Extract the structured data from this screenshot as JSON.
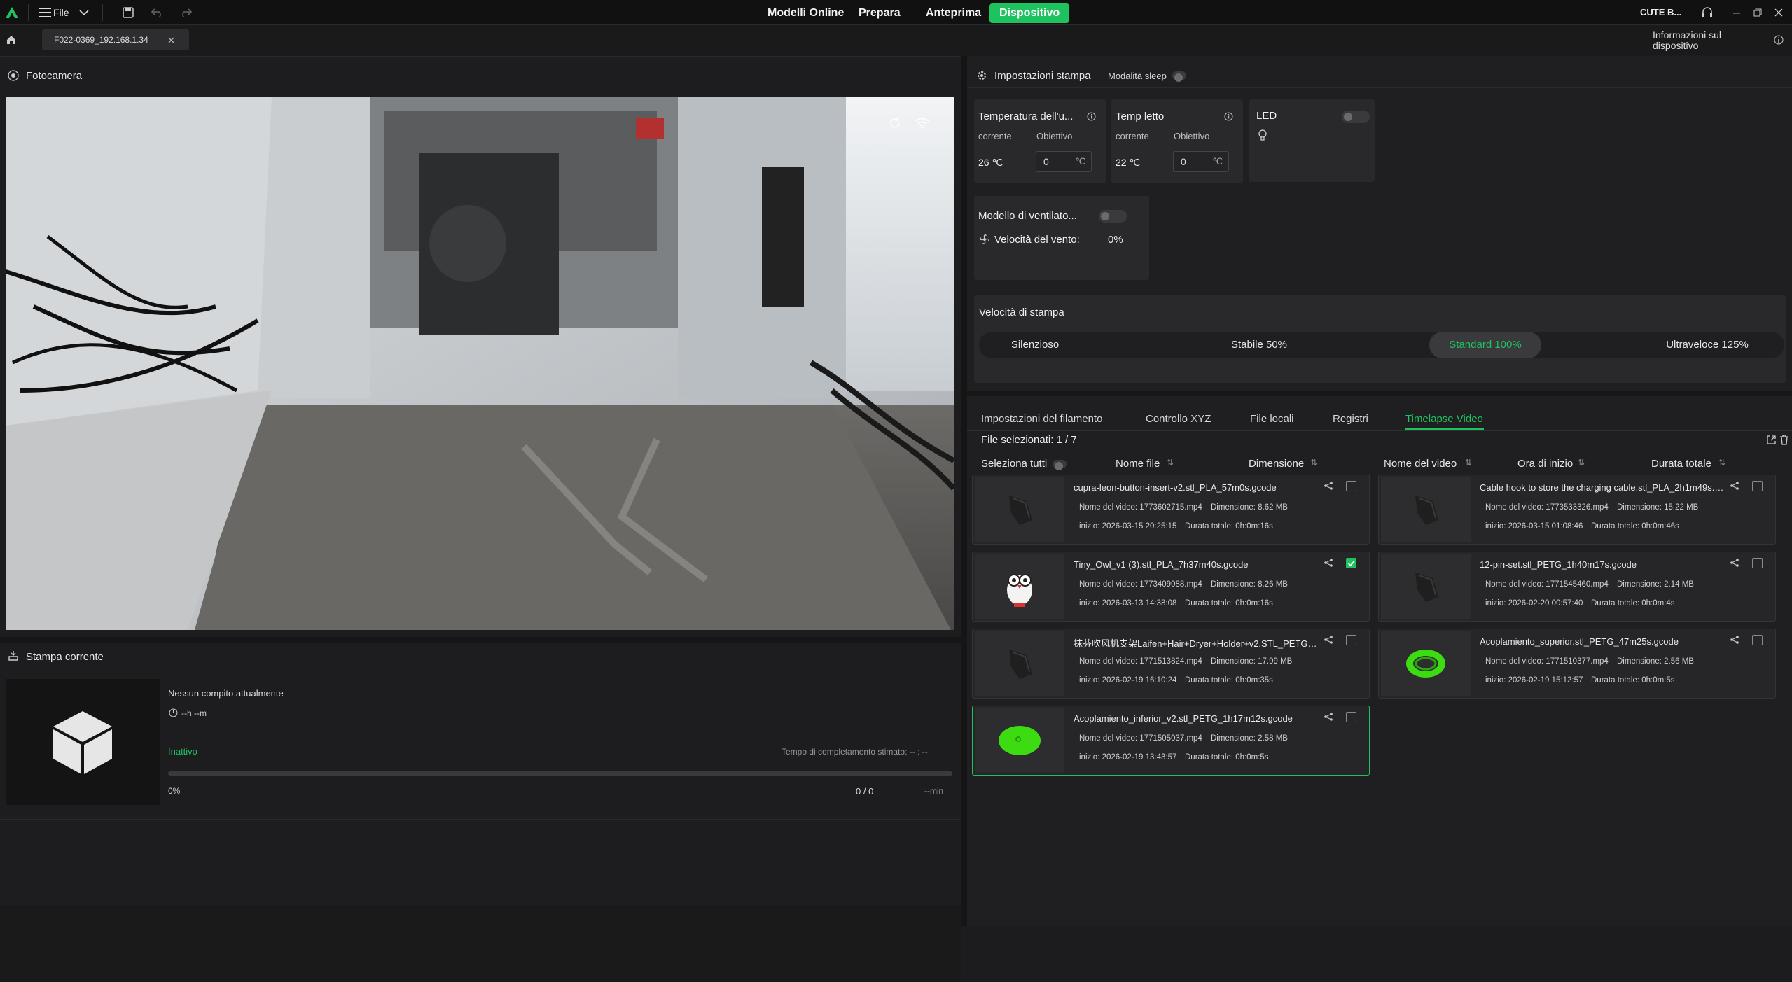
{
  "topbar": {
    "file_label": "File",
    "nav": [
      "Modelli Online",
      "Prepara",
      "Anteprima",
      "Dispositivo"
    ],
    "active_nav": "Dispositivo",
    "user": "CUTE B...",
    "accent_color": "#1ec25f"
  },
  "tabbar": {
    "device_tab": "F022-0369_192.168.1.34",
    "info_label": "Informazioni sul dispositivo"
  },
  "camera": {
    "title": "Fotocamera"
  },
  "current_print": {
    "title": "Stampa corrente",
    "status_text": "Nessun compito attualmente",
    "time": "--h --m",
    "state": "Inattivo",
    "eta_label": "Tempo di completamento stimato:  -- : --",
    "progress_percent": "0%",
    "progress_value": 0,
    "layers": "0 / 0",
    "remaining": "--min"
  },
  "settings": {
    "title": "Impostazioni stampa",
    "sleep_mode": "Modalità sleep",
    "nozzle": {
      "title": "Temperatura dell'u...",
      "current_label": "corrente",
      "target_label": "Obiettivo",
      "current": "26 ℃",
      "target": "0",
      "unit": "℃"
    },
    "bed": {
      "title": "Temp letto",
      "current_label": "corrente",
      "target_label": "Obiettivo",
      "current": "22 ℃",
      "target": "0",
      "unit": "℃"
    },
    "led": {
      "title": "LED"
    },
    "fan": {
      "title": "Modello di ventilato...",
      "speed_label": "Velocità del vento:",
      "speed": "0%"
    },
    "speed": {
      "title": "Velocità di stampa",
      "options": [
        "Silenzioso",
        "Stabile 50%",
        "Standard 100%",
        "Ultraveloce 125%"
      ],
      "selected": "Standard 100%"
    }
  },
  "lower_tabs": [
    "Impostazioni del filamento",
    "Controllo XYZ",
    "File locali",
    "Registri",
    "Timelapse Video"
  ],
  "active_lower_tab": "Timelapse Video",
  "timelapse": {
    "selected_label": "File selezionati:  1 / 7",
    "select_all": "Seleziona tutti",
    "columns": [
      "Nome file",
      "Dimensione",
      "Nome del video",
      "Ora di inizio",
      "Durata totale"
    ],
    "items": [
      {
        "name": "cupra-leon-button-insert-v2.stl_PLA_57m0s.gcode",
        "video": "Nome del video: 1773602715.mp4",
        "size": "Dimensione: 8.62 MB",
        "start": "inizio: 2026-03-15 20:25:15",
        "duration": "Durata totale: 0h:0m:16s",
        "checked": false,
        "thumb": "dark-part"
      },
      {
        "name": "Cable hook to store the charging cable.stl_PLA_2h1m49s.g...",
        "video": "Nome del video: 1773533326.mp4",
        "size": "Dimensione: 15.22 MB",
        "start": "inizio: 2026-03-15 01:08:46",
        "duration": "Durata totale: 0h:0m:46s",
        "checked": false,
        "thumb": "dark-part"
      },
      {
        "name": "Tiny_Owl_v1 (3).stl_PLA_7h37m40s.gcode",
        "video": "Nome del video: 1773409088.mp4",
        "size": "Dimensione: 8.26 MB",
        "start": "inizio: 2026-03-13 14:38:08",
        "duration": "Durata totale: 0h:0m:16s",
        "checked": true,
        "thumb": "owl"
      },
      {
        "name": "12-pin-set.stl_PETG_1h40m17s.gcode",
        "video": "Nome del video: 1771545460.mp4",
        "size": "Dimensione: 2.14 MB",
        "start": "inizio: 2026-02-20 00:57:40",
        "duration": "Durata totale: 0h:0m:4s",
        "checked": false,
        "thumb": "dark-part"
      },
      {
        "name": "抹芬吹风机支架Laifen+Hair+Dryer+Holder+v2.STL_PETG_2h...",
        "video": "Nome del video: 1771513824.mp4",
        "size": "Dimensione: 17.99 MB",
        "start": "inizio: 2026-02-19 16:10:24",
        "duration": "Durata totale: 0h:0m:35s",
        "checked": false,
        "thumb": "dark-part"
      },
      {
        "name": "Acoplamiento_superior.stl_PETG_47m25s.gcode",
        "video": "Nome del video: 1771510377.mp4",
        "size": "Dimensione: 2.56 MB",
        "start": "inizio: 2026-02-19 15:12:57",
        "duration": "Durata totale: 0h:0m:5s",
        "checked": false,
        "thumb": "green-ring"
      },
      {
        "name": "Acoplamiento_inferior_v2.stl_PETG_1h17m12s.gcode",
        "video": "Nome del video: 1771505037.mp4",
        "size": "Dimensione: 2.58 MB",
        "start": "inizio: 2026-02-19 13:43:57",
        "duration": "Durata totale: 0h:0m:5s",
        "checked": false,
        "thumb": "green-disc"
      }
    ]
  }
}
